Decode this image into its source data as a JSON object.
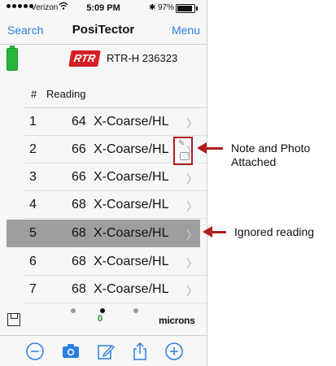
{
  "status_bar": {
    "carrier": "Verizon",
    "time": "5:09 PM",
    "battery_pct": "97%"
  },
  "nav": {
    "left": "Search",
    "title": "PosiTector",
    "right": "Menu"
  },
  "probe": {
    "logo": "RTR",
    "model": "RTR-H 236323"
  },
  "table": {
    "num_header": "#",
    "reading_header": "Reading",
    "rows": [
      {
        "num": "1",
        "value": "64",
        "class": "X-Coarse/HL"
      },
      {
        "num": "2",
        "value": "66",
        "class": "X-Coarse/HL"
      },
      {
        "num": "3",
        "value": "66",
        "class": "X-Coarse/HL"
      },
      {
        "num": "4",
        "value": "68",
        "class": "X-Coarse/HL"
      },
      {
        "num": "5",
        "value": "68",
        "class": "X-Coarse/HL"
      },
      {
        "num": "6",
        "value": "68",
        "class": "X-Coarse/HL"
      },
      {
        "num": "7",
        "value": "68",
        "class": "X-Coarse/HL"
      }
    ],
    "ignored_row_index": 4,
    "attachment_row_index": 1
  },
  "bottom": {
    "zero_label": "0",
    "units": "microns",
    "page_index": 1,
    "page_count": 3
  },
  "annotations": {
    "note_photo": "Note and Photo Attached",
    "ignored": "Ignored reading"
  },
  "icons": [
    "save-icon",
    "minus-circle-icon",
    "camera-icon",
    "edit-icon",
    "share-icon",
    "plus-circle-icon"
  ],
  "colors": {
    "accent": "#2a7fe0",
    "ignored_bg": "#9e9e9e",
    "annotation": "#b01e1e",
    "battery": "#27b53a"
  }
}
